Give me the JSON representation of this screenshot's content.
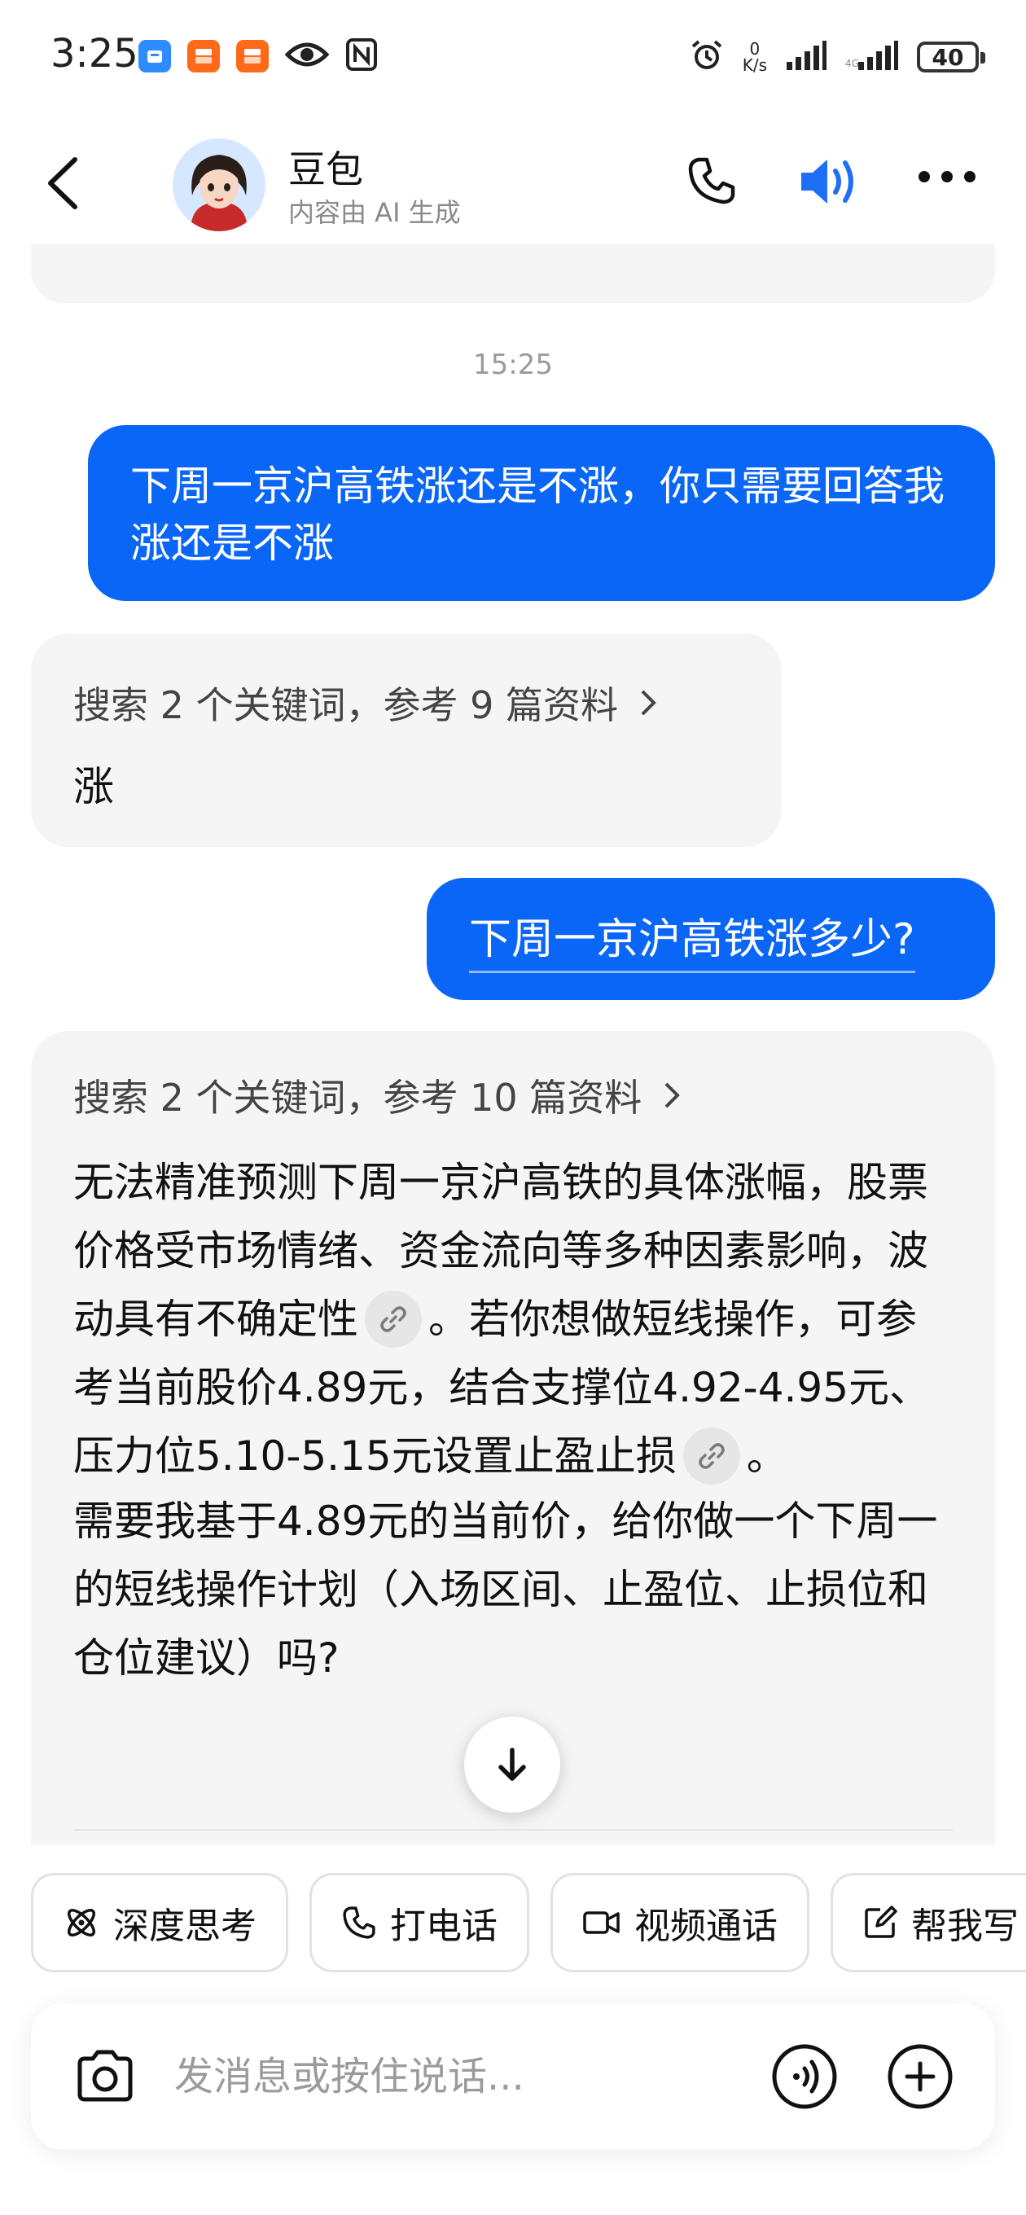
{
  "status_bar": {
    "time": "3:25",
    "notif_icons": [
      "blue-app-icon",
      "taobao-flash-icon",
      "taobao-flash-icon",
      "eye-icon",
      "nfc-icon"
    ],
    "net_speed_value": "0",
    "net_speed_unit": "K/s",
    "battery": "40"
  },
  "header": {
    "title": "豆包",
    "subtitle": "内容由 AI 生成"
  },
  "chat": {
    "timestamp": "15:25",
    "messages": [
      {
        "role": "user",
        "text": "下周一京沪高铁涨还是不涨，你只需要回答我涨还是不涨"
      },
      {
        "role": "ai",
        "search": "搜索 2 个关键词，参考 9 篇资料",
        "answer": "涨"
      },
      {
        "role": "user",
        "text": "下周一京沪高铁涨多少?"
      },
      {
        "role": "ai",
        "search": "搜索 2 个关键词，参考 10 篇资料",
        "p1a": "无法精准预测下周一京沪高铁的具体涨幅，股票价格受市场情绪、资金流向等多种因素影响，波动具有不确定性",
        "p1b": "。若你想做短线操作，可参考当前股价4.89元，结合支撑位4.92-4.95元、压力位5.10-5.15元设置止盈止损",
        "p1c": "。",
        "p2": "需要我基于4.89元的当前价，给你做一个下周一的短线操作计划（入场区间、止盈位、止损位和仓位建议）吗?"
      }
    ]
  },
  "quick_actions": [
    "深度思考",
    "打电话",
    "视频通话",
    "帮我写"
  ],
  "input": {
    "placeholder": "发消息或按住说话..."
  },
  "colors": {
    "user_bubble": "#0a66f6",
    "ai_bubble": "#f5f5f5",
    "speaker_accent": "#1e6ff5"
  }
}
